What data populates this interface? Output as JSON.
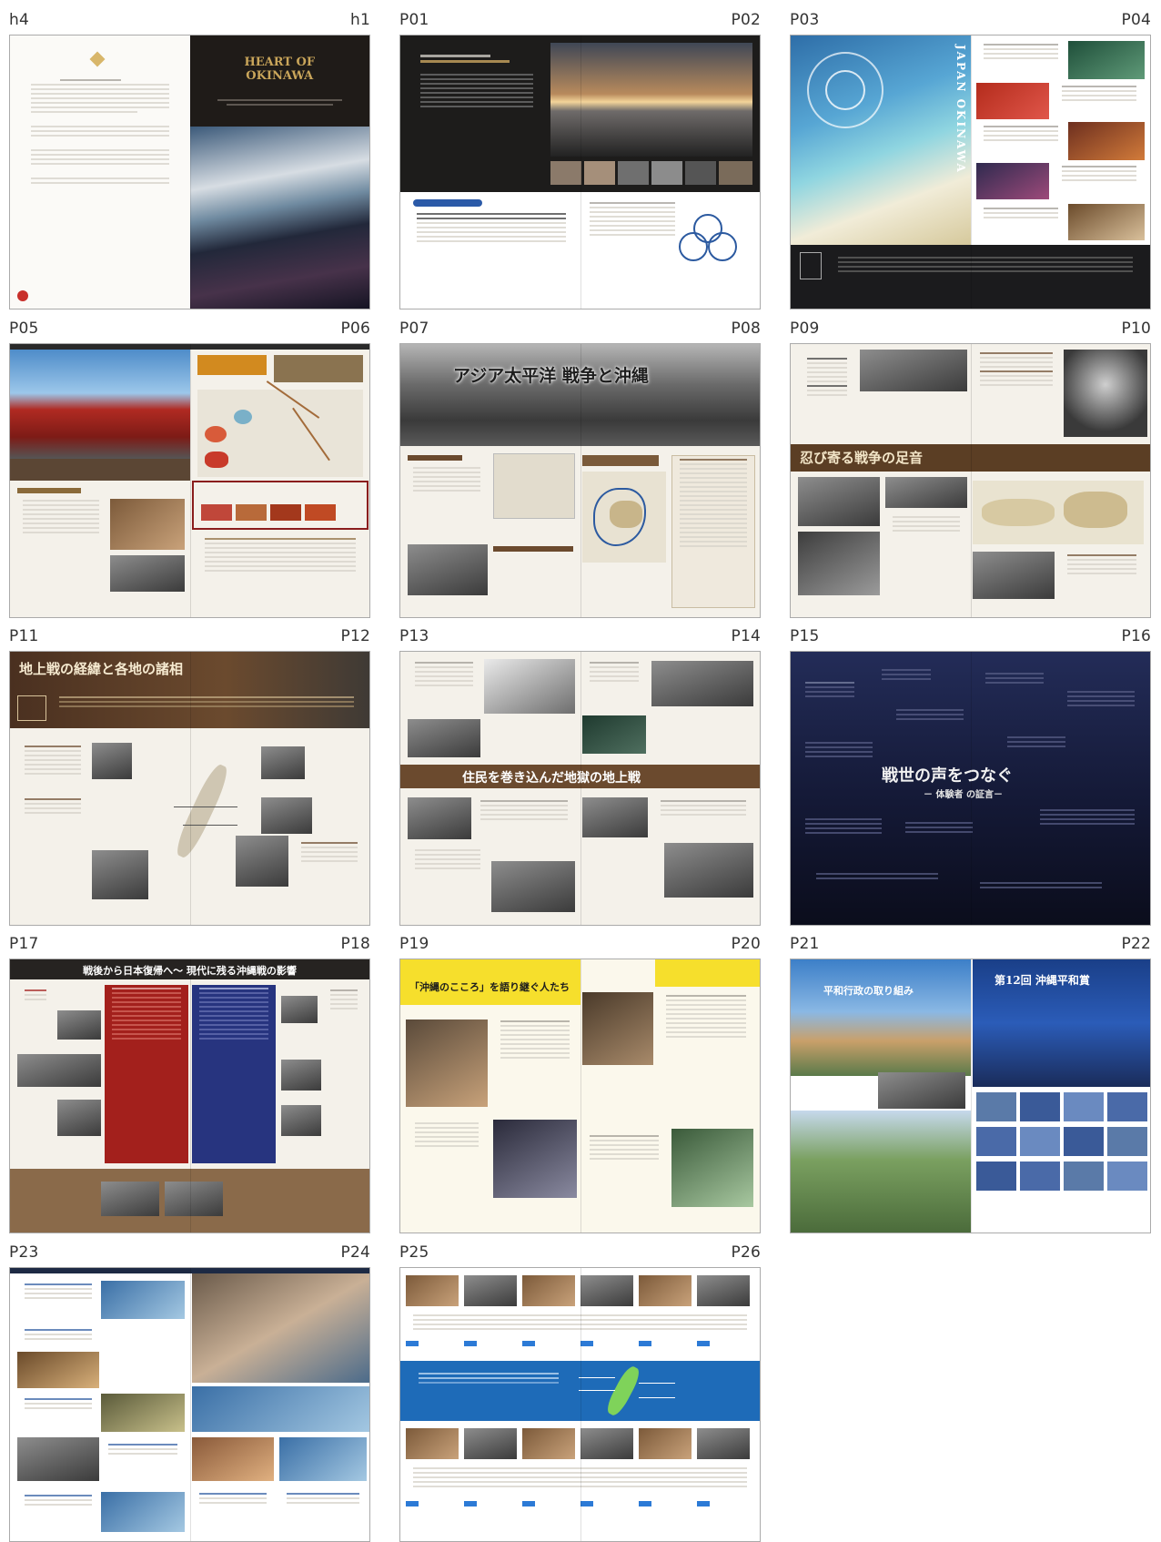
{
  "spreads": [
    {
      "left": "h4",
      "right": "h1",
      "cover_title_1": "HEART OF",
      "cover_title_2": "OKINAWA"
    },
    {
      "left": "P01",
      "right": "P02"
    },
    {
      "left": "P03",
      "right": "P04",
      "vertical_title": "JAPAN OKINAWA"
    },
    {
      "left": "P05",
      "right": "P06"
    },
    {
      "left": "P07",
      "right": "P08",
      "headline": "アジア太平洋 戦争と沖縄"
    },
    {
      "left": "P09",
      "right": "P10",
      "headline": "忍び寄る戦争の足音"
    },
    {
      "left": "P11",
      "right": "P12",
      "headline": "地上戦の経緯と各地の諸相"
    },
    {
      "left": "P13",
      "right": "P14",
      "headline": "住民を巻き込んだ地獄の地上戦"
    },
    {
      "left": "P15",
      "right": "P16",
      "headline": "戦世の声をつなぐ",
      "subhead": "－ 体験者 の証言－"
    },
    {
      "left": "P17",
      "right": "P18",
      "headline": "戦後から日本復帰へ～ 現代に残る沖縄戦の影響"
    },
    {
      "left": "P19",
      "right": "P20",
      "headline": "「沖縄のこころ」を語り継ぐ人たち"
    },
    {
      "left": "P21",
      "right": "P22",
      "headline": "第12回 沖縄平和賞",
      "subhead": "平和行政の取り組み"
    },
    {
      "left": "P23",
      "right": "P24"
    },
    {
      "left": "P25",
      "right": "P26"
    }
  ],
  "colors": {
    "dark": "#1f1b18",
    "sepia": "#5b4634",
    "brown_band": "#6b4a2e",
    "navy": "#1b2140",
    "red_panel": "#a3201c",
    "blue_panel": "#27347f",
    "yellow": "#f6df2c",
    "blue_bar": "#1e6bb8",
    "gold": "#c9a55a"
  }
}
